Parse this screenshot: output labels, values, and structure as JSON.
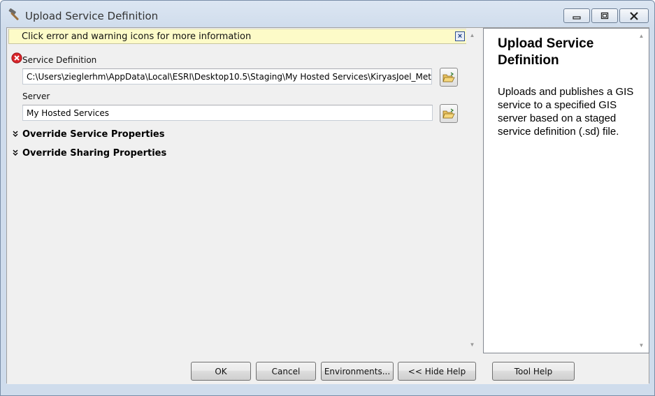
{
  "window": {
    "title": "Upload Service Definition",
    "icon": "hammer-icon",
    "controls": {
      "minimize": "minimize-icon",
      "maximize": "maximize-icon",
      "close": "close-icon"
    }
  },
  "message_bar": {
    "text": "Click error and warning icons for more information",
    "close_label": "×",
    "background": "#fdfbc8"
  },
  "form": {
    "service_definition": {
      "label": "Service Definition",
      "value": "C:\\Users\\zieglerhm\\AppData\\Local\\ESRI\\Desktop10.5\\Staging\\My Hosted Services\\KiryasJoel_Meters",
      "status_icon": "error-icon"
    },
    "server": {
      "label": "Server",
      "value": "My Hosted Services"
    },
    "sections": [
      {
        "label": "Override Service Properties",
        "icon": "double-chevron-down-icon"
      },
      {
        "label": "Override Sharing Properties",
        "icon": "double-chevron-down-icon"
      }
    ]
  },
  "help": {
    "title": "Upload Service Definition",
    "body": "Uploads and publishes a GIS service to a specified GIS server based on a staged service definition (.sd) file."
  },
  "buttons": {
    "ok": "OK",
    "cancel": "Cancel",
    "environments": "Environments...",
    "hide_help": "<< Hide Help",
    "tool_help": "Tool Help"
  },
  "colors": {
    "error": "#d9252a",
    "accent": "#1b3f84"
  }
}
